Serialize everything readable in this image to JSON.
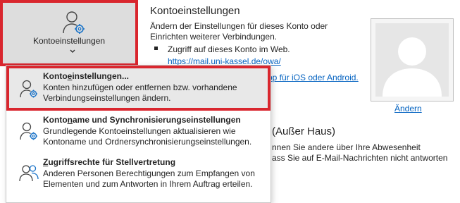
{
  "tile": {
    "label": "Kontoeinstellungen",
    "icon": "person-gear-icon"
  },
  "pane": {
    "heading": "Kontoeinstellungen",
    "description": "Ändern der Einstellungen für dieses Konto oder Einrichten weiterer Verbindungen.",
    "bullet": "Zugriff auf dieses Konto im Web.",
    "web_link": "https://mail.uni-kassel.de/owa/",
    "app_link": "pp für iOS oder Android.",
    "change_link": "Ändern"
  },
  "out_of_office": {
    "heading": "(Außer Haus)",
    "line1": "nnen Sie andere über Ihre Abwesenheit",
    "line2": "ass Sie auf E-Mail-Nachrichten nicht antworten"
  },
  "menu": {
    "items": [
      {
        "title_pre": "Konto",
        "title_acc": "e",
        "title_post": "instellungen...",
        "description": "Konten hinzufügen oder entfernen bzw. vorhandene Verbindungseinstellungen ändern.",
        "icon": "person-gear-icon"
      },
      {
        "title_pre": "Konto",
        "title_acc": "n",
        "title_post": "ame und Synchronisierungseinstellungen",
        "description": "Grundlegende Kontoeinstellungen aktualisieren wie Kontoname und Ordnersynchronisierungseinstellungen.",
        "icon": "person-gear-icon"
      },
      {
        "title_pre": "",
        "title_acc": "Z",
        "title_post": "ugriffsrechte für Stellvertretung",
        "description": "Anderen Personen Berechtigungen zum Empfangen von Elementen und zum Antworten in Ihrem Auftrag erteilen.",
        "icon": "people-icon"
      }
    ]
  }
}
